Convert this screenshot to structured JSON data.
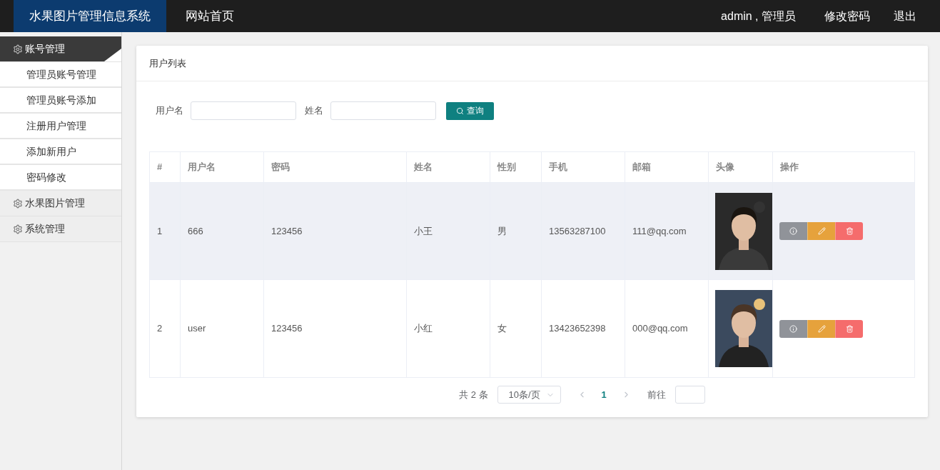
{
  "topbar": {
    "brand": "水果图片管理信息系统",
    "nav": [
      {
        "label": "网站首页",
        "selected": false
      }
    ],
    "user": "admin , 管理员",
    "links": [
      "修改密码",
      "退出"
    ]
  },
  "sidebar": {
    "groups": [
      {
        "label": "账号管理",
        "expanded": true,
        "children": [
          {
            "label": "管理员账号管理"
          },
          {
            "label": "管理员账号添加"
          },
          {
            "label": "注册用户管理"
          },
          {
            "label": "添加新用户"
          },
          {
            "label": "密码修改"
          }
        ]
      },
      {
        "label": "水果图片管理",
        "expanded": false
      },
      {
        "label": "系统管理",
        "expanded": false
      }
    ]
  },
  "card": {
    "title": "用户列表",
    "search": {
      "fields": [
        {
          "label": "用户名"
        },
        {
          "label": "姓名"
        }
      ],
      "button": "查询"
    },
    "table": {
      "columns": [
        "#",
        "用户名",
        "密码",
        "姓名",
        "性别",
        "手机",
        "邮箱",
        "头像",
        "操作"
      ],
      "rows": [
        {
          "highlighted": true,
          "cells": [
            "1",
            "666",
            "123456",
            "小王",
            "男",
            "13563287100",
            "111@qq.com"
          ]
        },
        {
          "highlighted": false,
          "cells": [
            "2",
            "user",
            "123456",
            "小红",
            "女",
            "13423652398",
            "000@qq.com"
          ]
        }
      ]
    },
    "pagination": {
      "total": "共 2 条",
      "page_size": "10条/页",
      "pages": [
        {
          "label": "1",
          "selected": true
        }
      ],
      "goto": "前往"
    }
  }
}
